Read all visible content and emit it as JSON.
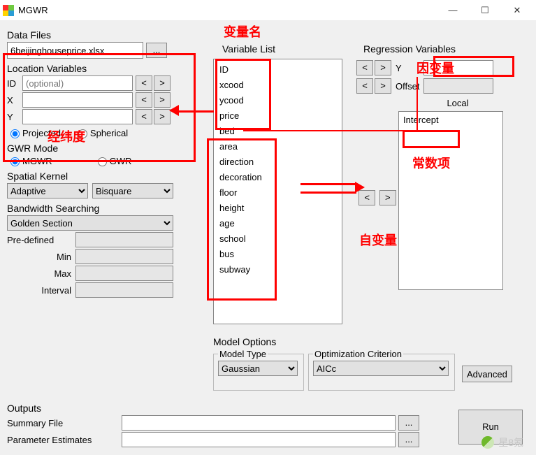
{
  "window": {
    "title": "MGWR",
    "min": "—",
    "max": "☐",
    "close": "✕"
  },
  "left": {
    "data_files_label": "Data Files",
    "data_files_value": "6beijinghouseprice.xlsx",
    "browse": "...",
    "loc_vars_label": "Location Variables",
    "id_label": "ID",
    "id_placeholder": "(optional)",
    "x_label": "X",
    "y_label": "Y",
    "projected": "Projected",
    "spherical": "Spherical",
    "gwr_mode_label": "GWR Mode",
    "mgwr": "MGWR",
    "gwr": "GWR",
    "spatial_kernel_label": "Spatial Kernel",
    "kernel_type": "Adaptive",
    "kernel_func": "Bisquare",
    "bw_search_label": "Bandwidth Searching",
    "bw_method": "Golden Section",
    "predef_label": "Pre-defined",
    "min_label": "Min",
    "max_label": "Max",
    "interval_label": "Interval",
    "lt": "<",
    "gt": ">"
  },
  "varlist": {
    "label": "Variable List",
    "items": [
      "ID",
      "xcood",
      "ycood",
      "price",
      "bed",
      "area",
      "direction",
      "decoration",
      "floor",
      "height",
      "age",
      "school",
      "bus",
      "subway"
    ]
  },
  "regvars": {
    "label": "Regression Variables",
    "y_label": "Y",
    "offset_label": "Offset",
    "local_label": "Local",
    "intercept": "Intercept",
    "lt": "<",
    "gt": ">"
  },
  "model": {
    "label": "Model Options",
    "type_label": "Model Type",
    "type": "Gaussian",
    "crit_label": "Optimization Criterion",
    "crit": "AICc",
    "advanced": "Advanced"
  },
  "outputs": {
    "label": "Outputs",
    "summary_label": "Summary File",
    "params_label": "Parameter Estimates",
    "browse": "..."
  },
  "run": "Run",
  "annotations": {
    "a1": "变量名",
    "a2": "经纬度",
    "a3": "因变量",
    "a4": "常数项",
    "a5": "自变量"
  },
  "watermark": "星8氪"
}
